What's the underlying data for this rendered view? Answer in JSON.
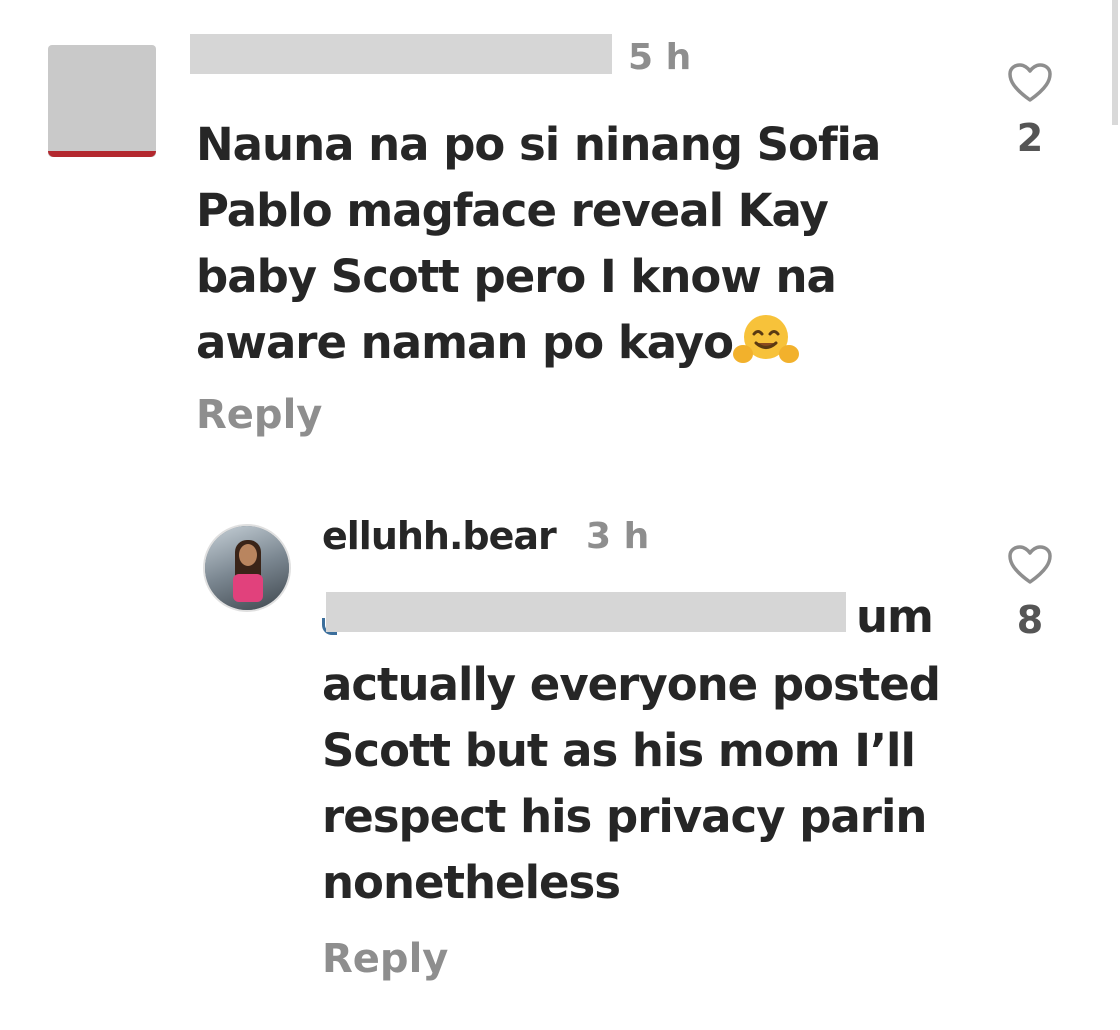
{
  "comments": [
    {
      "username_visible": "",
      "time": "5 h",
      "text": "Nauna na po si ninang Sofia Pablo magface reveal Kay baby Scott pero I know na aware naman po kayo",
      "emoji": "hugging-face",
      "reply_label": "Reply",
      "likes": "2"
    },
    {
      "username": "elluhh.bear",
      "time": "3 h",
      "text_first": "um",
      "text": "actually everyone posted Scott but as his mom I’ll respect his privacy parin nonetheless",
      "reply_label": "Reply",
      "likes": "8"
    }
  ],
  "colors": {
    "text": "#262626",
    "muted": "#8e8e8e",
    "redaction": "#d6d6d6"
  }
}
